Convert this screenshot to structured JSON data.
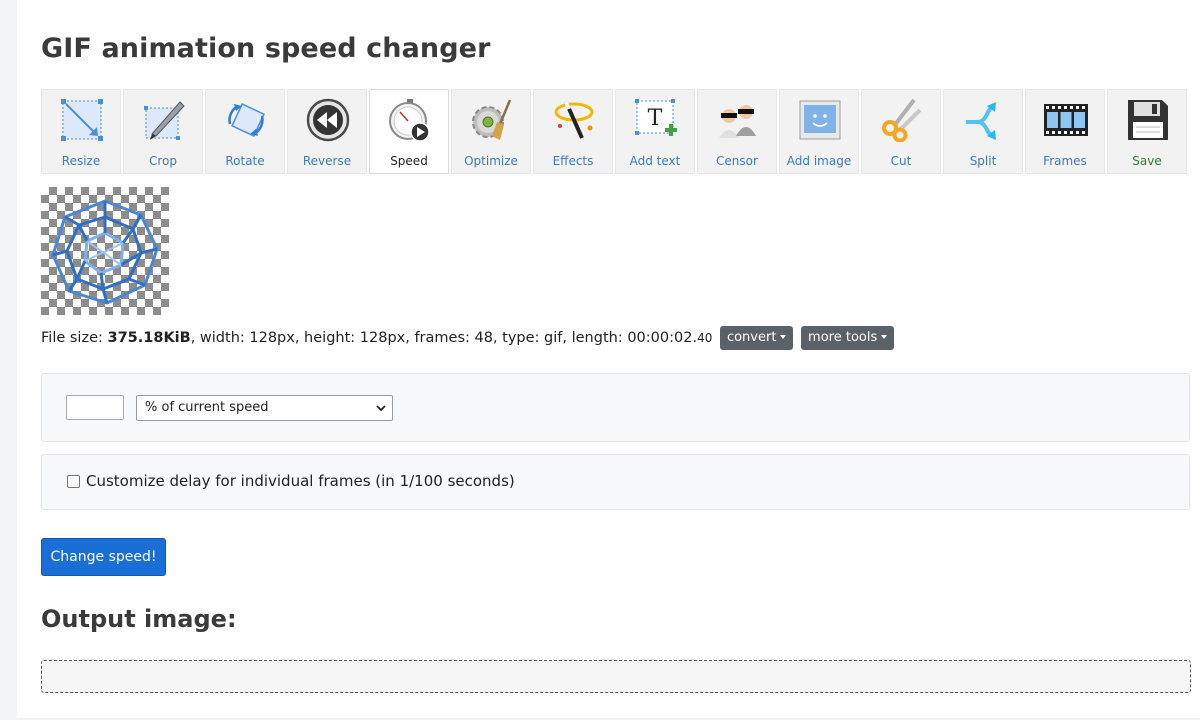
{
  "page": {
    "title": "GIF animation speed changer"
  },
  "toolbar": {
    "tools": [
      {
        "label": "Resize",
        "icon": "resize-icon"
      },
      {
        "label": "Crop",
        "icon": "crop-icon"
      },
      {
        "label": "Rotate",
        "icon": "rotate-icon"
      },
      {
        "label": "Reverse",
        "icon": "reverse-icon"
      },
      {
        "label": "Speed",
        "icon": "speed-icon",
        "active": true
      },
      {
        "label": "Optimize",
        "icon": "optimize-icon"
      },
      {
        "label": "Effects",
        "icon": "effects-icon"
      },
      {
        "label": "Add text",
        "icon": "add-text-icon"
      },
      {
        "label": "Censor",
        "icon": "censor-icon"
      },
      {
        "label": "Add image",
        "icon": "add-image-icon"
      },
      {
        "label": "Cut",
        "icon": "scissors-icon"
      },
      {
        "label": "Split",
        "icon": "split-icon"
      },
      {
        "label": "Frames",
        "icon": "film-strip-icon"
      },
      {
        "label": "Save",
        "icon": "floppy-disk-icon"
      }
    ]
  },
  "file_info": {
    "size_label": "File size: ",
    "size_value": "375.18KiB",
    "details": ", width: 128px, height: 128px, frames: 48, type: gif, length: 00:00:02.",
    "length_fraction": "40",
    "convert_label": "convert",
    "more_tools_label": "more tools"
  },
  "speed_form": {
    "speed_value": "",
    "unit_selected": "% of current speed",
    "custom_delay_checked": false,
    "custom_delay_label": "Customize delay for individual frames (in 1/100 seconds)",
    "submit_label": "Change speed!"
  },
  "output": {
    "title": "Output image:"
  },
  "colors": {
    "accent": "#1a6fd6",
    "link": "#3d7ab8",
    "save": "#2e7d32",
    "dropdown": "#5a6268"
  }
}
